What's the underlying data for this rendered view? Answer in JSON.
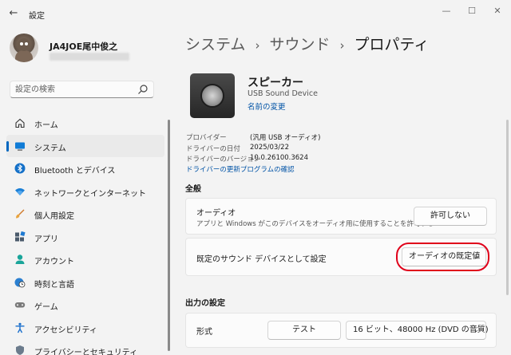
{
  "window": {
    "title": "設定",
    "back_icon": "back-arrow-icon",
    "controls": {
      "minimize": "—",
      "maximize": "☐",
      "close": "✕"
    }
  },
  "user": {
    "name": "JA4JOE尾中俊之"
  },
  "search": {
    "placeholder": "設定の検索"
  },
  "sidebar": {
    "items": [
      {
        "label": "ホーム",
        "icon": "home-icon"
      },
      {
        "label": "システム",
        "icon": "system-icon",
        "active": true
      },
      {
        "label": "Bluetooth とデバイス",
        "icon": "bluetooth-icon"
      },
      {
        "label": "ネットワークとインターネット",
        "icon": "wifi-icon"
      },
      {
        "label": "個人用設定",
        "icon": "brush-icon"
      },
      {
        "label": "アプリ",
        "icon": "apps-icon"
      },
      {
        "label": "アカウント",
        "icon": "account-icon"
      },
      {
        "label": "時刻と言語",
        "icon": "clock-globe-icon"
      },
      {
        "label": "ゲーム",
        "icon": "gamepad-icon"
      },
      {
        "label": "アクセシビリティ",
        "icon": "accessibility-icon"
      },
      {
        "label": "プライバシーとセキュリティ",
        "icon": "shield-icon"
      }
    ]
  },
  "breadcrumb": {
    "part1": "システム",
    "part2": "サウンド",
    "part3": "プロパティ",
    "separator": "›"
  },
  "device": {
    "name": "スピーカー",
    "subtitle": "USB Sound Device",
    "rename_label": "名前の変更"
  },
  "driver": {
    "rows": [
      {
        "key": "プロバイダー",
        "value": "(汎用 USB オーディオ)"
      },
      {
        "key": "ドライバーの日付",
        "value": "2025/03/22"
      },
      {
        "key": "ドライバーのバージョン",
        "value": "10.0.26100.3624"
      }
    ],
    "update_link": "ドライバーの更新プログラムの確認"
  },
  "general": {
    "heading": "全般",
    "audio": {
      "title": "オーディオ",
      "description": "アプリと Windows がこのデバイスをオーディオ用に使用することを許可する",
      "button": "許可しない"
    },
    "default_device": {
      "title": "既定のサウンド デバイスとして設定",
      "dropdown": "オーディオの既定値"
    }
  },
  "output": {
    "heading": "出力の設定",
    "format": {
      "title": "形式",
      "test_button": "テスト",
      "dropdown": "16 ビット、48000 Hz (DVD の音質)"
    }
  },
  "colors": {
    "accent": "#0067c0",
    "link": "#0053a6",
    "highlight": "#e0001a"
  }
}
